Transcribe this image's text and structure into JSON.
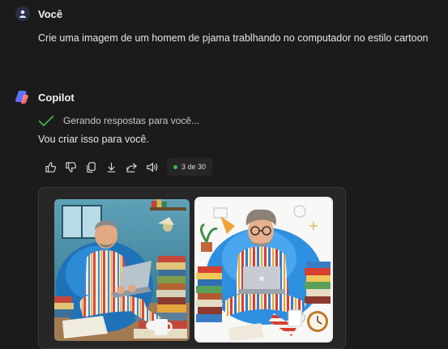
{
  "user": {
    "name": "Você",
    "prompt": "Crie uma imagem de um homem de pjama trablhando no computador no estilo cartoon"
  },
  "assistant": {
    "name": "Copilot",
    "status": "Gerando respostas para você...",
    "reply": "Vou criar isso para você.",
    "counter": "3 de 30",
    "counter_color": "#3fb850"
  },
  "actions": [
    "thumbs-up-icon",
    "thumbs-down-icon",
    "copy-icon",
    "download-icon",
    "share-icon",
    "speaker-icon"
  ],
  "images": [
    "generated-image-1",
    "generated-image-2"
  ]
}
